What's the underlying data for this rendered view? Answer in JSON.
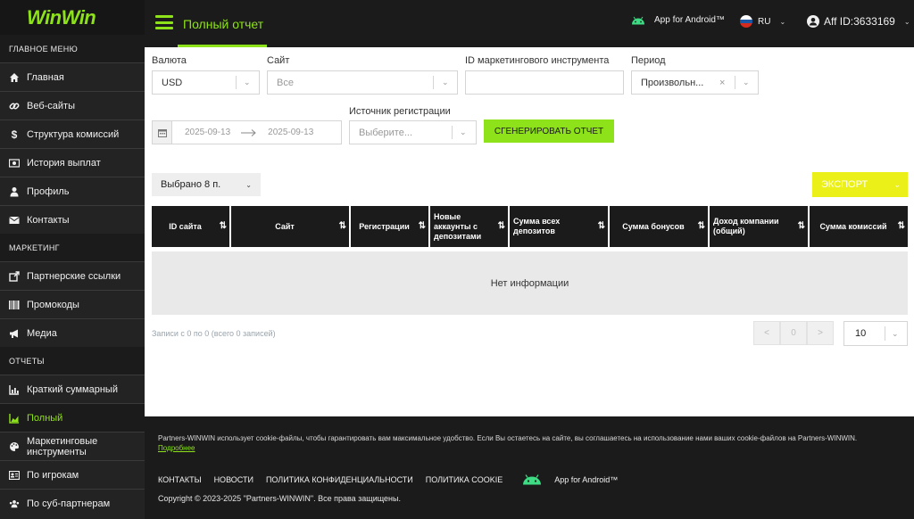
{
  "brand": {
    "logo_text": "WinWin",
    "accent": "#8ee21a"
  },
  "sidebar": {
    "sections": [
      {
        "label": "ГЛАВНОЕ МЕНЮ"
      },
      {
        "label": "МАРКЕТИНГ"
      },
      {
        "label": "ОТЧЕТЫ"
      }
    ],
    "items": [
      {
        "label": "Главная",
        "icon": "home-icon"
      },
      {
        "label": "Веб-сайты",
        "icon": "link-icon"
      },
      {
        "label": "Структура комиссий",
        "icon": "dollar-icon"
      },
      {
        "label": "История выплат",
        "icon": "money-icon"
      },
      {
        "label": "Профиль",
        "icon": "user-icon"
      },
      {
        "label": "Контакты",
        "icon": "envelope-icon"
      },
      {
        "label": "Партнерские ссылки",
        "icon": "external-link-icon"
      },
      {
        "label": "Промокоды",
        "icon": "barcode-icon"
      },
      {
        "label": "Медиа",
        "icon": "bullhorn-icon"
      },
      {
        "label": "Краткий суммарный",
        "icon": "bar-chart-icon"
      },
      {
        "label": "Полный",
        "icon": "area-chart-icon"
      },
      {
        "label": "Маркетинговые инструменты",
        "icon": "palette-icon"
      },
      {
        "label": "По игрокам",
        "icon": "id-card-icon"
      },
      {
        "label": "По суб-партнерам",
        "icon": "users-icon"
      }
    ]
  },
  "header": {
    "title": "Полный отчет",
    "android_label": "App for Android™",
    "language": "RU",
    "user": "Aff ID:3633169"
  },
  "filters": {
    "currency_label": "Валюта",
    "currency_value": "USD",
    "site_label": "Сайт",
    "site_value": "Все",
    "tool_id_label": "ID маркетингового инструмента",
    "tool_id_value": "",
    "period_label": "Период",
    "period_value": "Произвольн...",
    "date_from": "2025-09-13",
    "date_to": "2025-09-13",
    "source_label": "Источник регистрации",
    "source_placeholder": "Выберите...",
    "generate_label": "Сгенерировать отчет"
  },
  "toolbar": {
    "selected_label": "Выбрано 8 п.",
    "export_label": "Экспорт",
    "export_color": "#eaf018"
  },
  "table": {
    "columns": [
      "ID сайта",
      "Сайт",
      "Регистрации",
      "Новые аккаунты с депозитами",
      "Сумма всех депозитов",
      "Сумма бонусов",
      "Доход компании (общий)",
      "Сумма комиссий"
    ],
    "empty_text": "Нет информации"
  },
  "pagination": {
    "records_text": "Записи с 0 по 0 (всего 0 записей)",
    "prev": "<",
    "current": "0",
    "next": ">",
    "per_page": "10"
  },
  "footer": {
    "cookie_text": "Partners-WINWIN использует cookie-файлы, чтобы гарантировать вам максимальное удобство. Если Вы остаетесь на сайте, вы соглашаетесь на использование нами ваших cookie-файлов на Partners-WINWIN.",
    "cookie_link": "Подробнее",
    "links": [
      "Контакты",
      "Новости",
      "Политика конфиденциальности",
      "Политика cookie"
    ],
    "android_label": "App for Android™",
    "copyright": "Copyright © 2023-2025 \"Partners-WINWIN\". Все права защищены."
  }
}
